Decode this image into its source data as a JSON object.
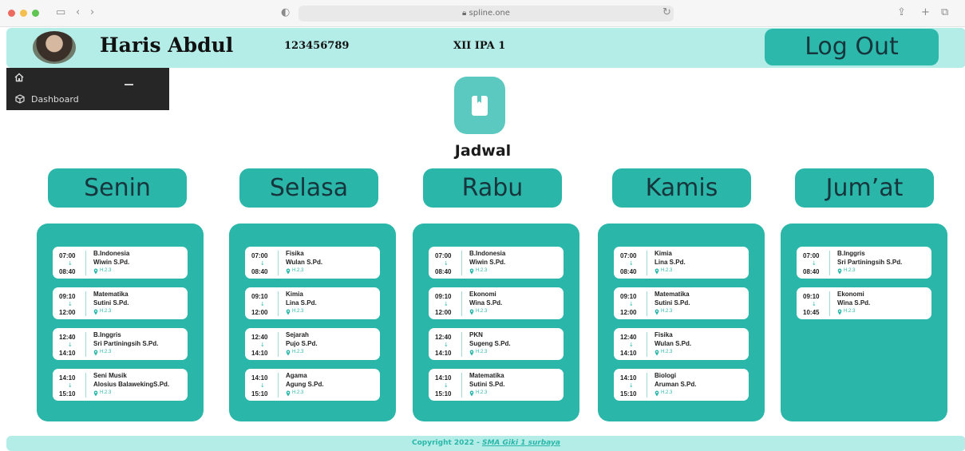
{
  "browser": {
    "url": "spline.one"
  },
  "header": {
    "name": "Haris Abdul",
    "nis": "123456789",
    "class": "XII IPA 1",
    "logout_label": "Log Out"
  },
  "sidebar": {
    "items": [
      {
        "label": "",
        "icon": "home-icon"
      },
      {
        "label": "Dashboard",
        "icon": "cube-icon"
      }
    ]
  },
  "page": {
    "title": "Jadwal",
    "icon": "bookmark-icon"
  },
  "days": [
    {
      "name": "Senin",
      "slots": [
        {
          "start": "07:00",
          "end": "08:40",
          "subject": "B.Indonesia",
          "teacher": "Wiwin S.Pd.",
          "room": "H.2.3"
        },
        {
          "start": "09:10",
          "end": "12:00",
          "subject": "Matematika",
          "teacher": "Sutini S.Pd.",
          "room": "H.2.3"
        },
        {
          "start": "12:40",
          "end": "14:10",
          "subject": "B.Inggris",
          "teacher": "Sri Partiningsih S.Pd.",
          "room": "H.2.3"
        },
        {
          "start": "14:10",
          "end": "15:10",
          "subject": "Seni Musik",
          "teacher": "Alosius BalawekingS.Pd.",
          "room": "H.2.3"
        }
      ]
    },
    {
      "name": "Selasa",
      "slots": [
        {
          "start": "07:00",
          "end": "08:40",
          "subject": "Fisika",
          "teacher": "Wulan S.Pd.",
          "room": "H.2.3"
        },
        {
          "start": "09:10",
          "end": "12:00",
          "subject": "Kimia",
          "teacher": "Lina S.Pd.",
          "room": "H.2.3"
        },
        {
          "start": "12:40",
          "end": "14:10",
          "subject": "Sejarah",
          "teacher": "Pujo S.Pd.",
          "room": "H.2.3"
        },
        {
          "start": "14:10",
          "end": "15:10",
          "subject": "Agama",
          "teacher": "Agung S.Pd.",
          "room": "H.2.3"
        }
      ]
    },
    {
      "name": "Rabu",
      "slots": [
        {
          "start": "07:00",
          "end": "08:40",
          "subject": "B.Indonesia",
          "teacher": "Wiwin S.Pd.",
          "room": "H.2.3"
        },
        {
          "start": "09:10",
          "end": "12:00",
          "subject": "Ekonomi",
          "teacher": "Wina S.Pd.",
          "room": "H.2.3"
        },
        {
          "start": "12:40",
          "end": "14:10",
          "subject": "PKN",
          "teacher": "Sugeng S.Pd.",
          "room": "H.2.3"
        },
        {
          "start": "14:10",
          "end": "15:10",
          "subject": "Matematika",
          "teacher": "Sutini S.Pd.",
          "room": "H.2.3"
        }
      ]
    },
    {
      "name": "Kamis",
      "slots": [
        {
          "start": "07:00",
          "end": "08:40",
          "subject": "Kimia",
          "teacher": "Lina S.Pd.",
          "room": "H.2.3"
        },
        {
          "start": "09:10",
          "end": "12:00",
          "subject": "Matematika",
          "teacher": "Sutini S.Pd.",
          "room": "H.2.3"
        },
        {
          "start": "12:40",
          "end": "14:10",
          "subject": "Fisika",
          "teacher": "Wulan S.Pd.",
          "room": "H.2.3"
        },
        {
          "start": "14:10",
          "end": "15:10",
          "subject": "Biologi",
          "teacher": "Aruman S.Pd.",
          "room": "H.2.3"
        }
      ]
    },
    {
      "name": "Jum’at",
      "slots": [
        {
          "start": "07:00",
          "end": "08:40",
          "subject": "B.Inggris",
          "teacher": "Sri Partiningsih S.Pd.",
          "room": "H.2.3"
        },
        {
          "start": "09:10",
          "end": "10:45",
          "subject": "Ekonomi",
          "teacher": "Wina S.Pd.",
          "room": "H.2.3"
        }
      ]
    }
  ],
  "footer": {
    "prefix": "Copyright 2022 - ",
    "link": "SMA Giki 1 surbaya"
  },
  "colors": {
    "accent": "#2ab7a9",
    "header_bg": "#b4ede8",
    "sidebar_bg": "#262626",
    "tile": "#5cc9c1"
  }
}
